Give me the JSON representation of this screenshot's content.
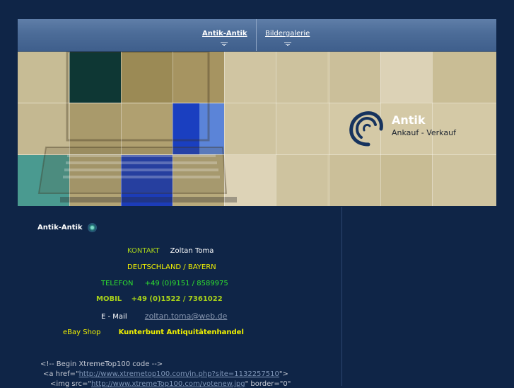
{
  "nav": {
    "items": [
      {
        "label": "Antik-Antik",
        "active": true
      },
      {
        "label": "Bildergalerie",
        "active": false
      }
    ]
  },
  "banner": {
    "logo_title": "Antik",
    "logo_subtitle": "Ankauf - Verkauf",
    "colors": {
      "tan": "#c9bd95",
      "dark_teal": "#0d3a36",
      "blue": "#1a3fc0",
      "light_blue": "#5b84d8",
      "teal": "#4a9a90"
    }
  },
  "content": {
    "section_title": "Antik-Antik",
    "kontakt_label": "KONTAKT",
    "kontakt_name": "Zoltan Toma",
    "region": "DEUTSCHLAND / BAYERN",
    "telefon_label": "TELEFON",
    "telefon_number": "+49 (0)9151 /  8589975",
    "mobil_label": "MOBIL",
    "mobil_number": "+49 (0)1522  / 7361022",
    "email_label": "E - Mail",
    "email_address": "zoltan.toma@web.de",
    "ebay_label": "eBay  Shop",
    "shop_name": "Kunterbunt  Antiquitätenhandel"
  },
  "code": {
    "line1": "<!-- Begin XtremeTop100 code -->",
    "line2_pre": "<a href=\"",
    "line2_link": "http://www.xtremetop100.com/in.php?site=1132257510",
    "line2_post": "\">",
    "line3_pre": "<img  src=\"",
    "line3_link": "http://www.xtremeTop100.com/votenew.jpg",
    "line3_post": "\"   border=\"0\""
  },
  "colors": {
    "background": "#0f2547",
    "nav_blue": "#4c6c98",
    "yellow": "#f2f200",
    "green": "#2fe02f",
    "olive": "#a8d21a"
  }
}
